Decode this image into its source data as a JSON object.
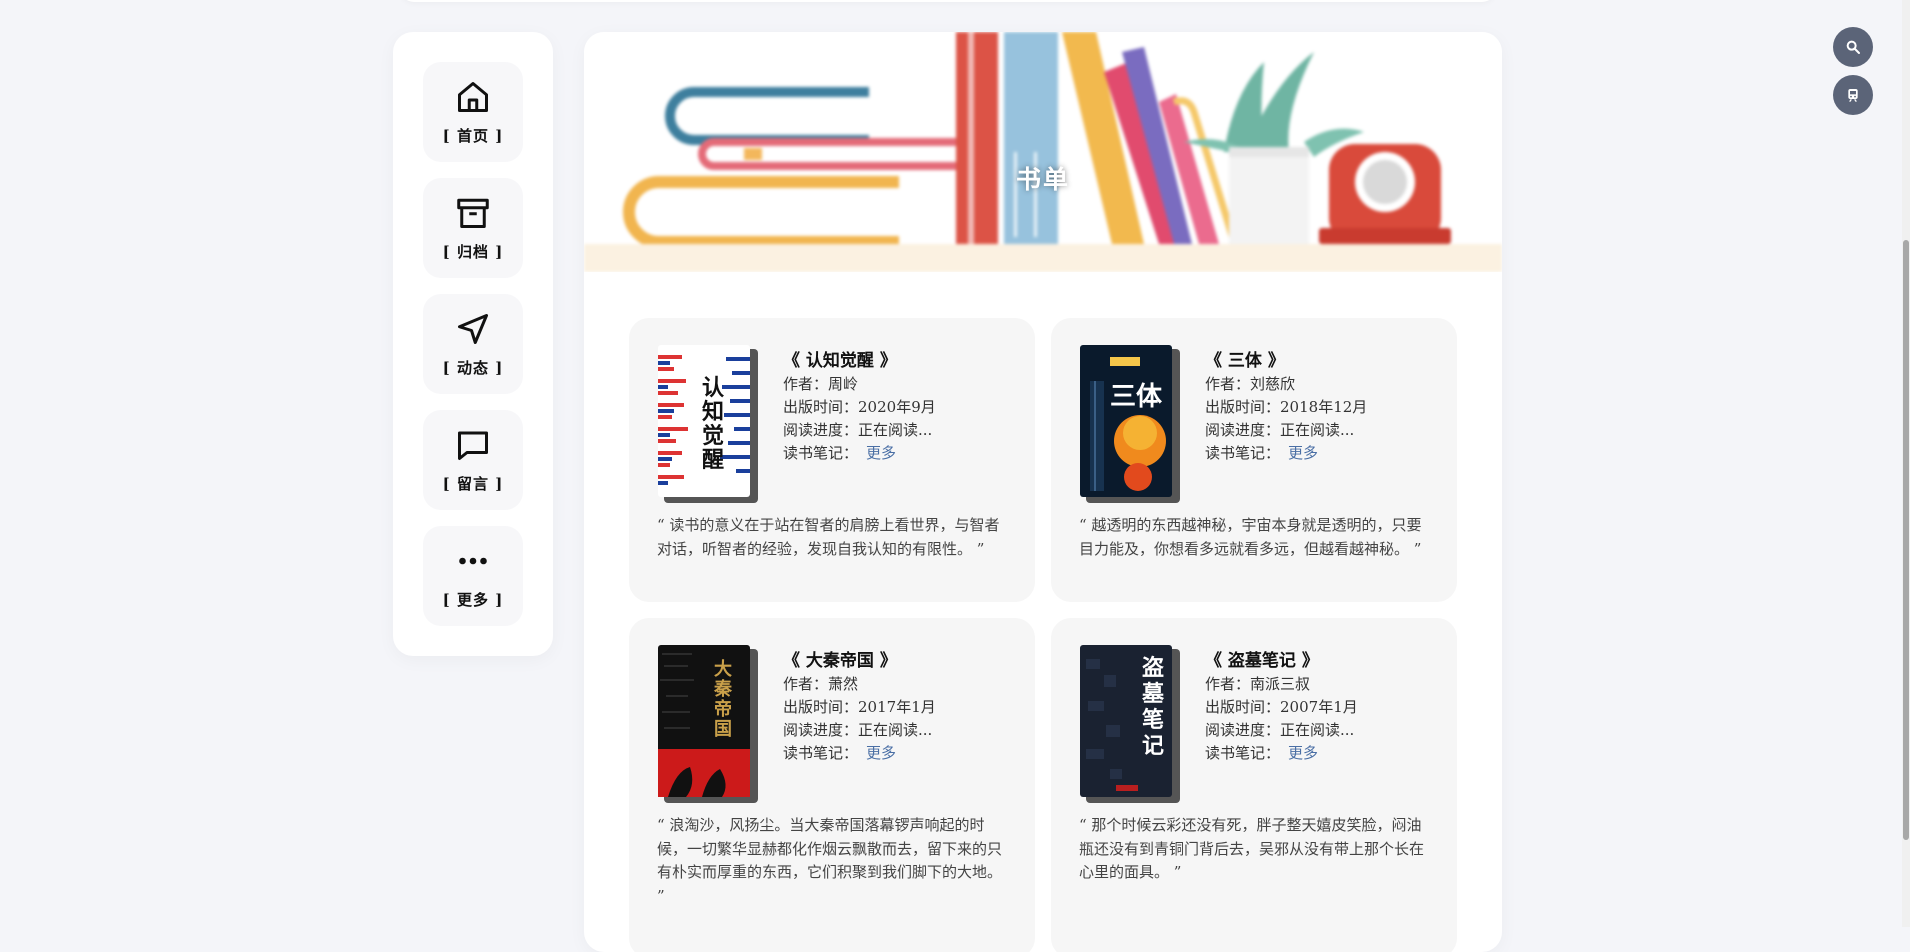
{
  "nav": {
    "items": [
      {
        "label": "[ 首页 ]",
        "icon": "home-icon"
      },
      {
        "label": "[ 归档 ]",
        "icon": "archive-icon"
      },
      {
        "label": "[ 动态 ]",
        "icon": "send-icon"
      },
      {
        "label": "[ 留言 ]",
        "icon": "message-icon"
      },
      {
        "label": "[ 更多 ]",
        "icon": "more-icon"
      }
    ]
  },
  "banner": {
    "title": "书单"
  },
  "labels": {
    "author": "作者：",
    "published": "出版时间：",
    "progress": "阅读进度：",
    "notes": "读书笔记："
  },
  "books": [
    {
      "title": "《 认知觉醒 》",
      "author": "周岭",
      "published": "2020年9月",
      "progress": "正在阅读...",
      "notes_link": "更多",
      "quote": "“ 读书的意义在于站在智者的肩膀上看世界，与智者对话，听智者的经验，发现自我认知的有限性。 ”",
      "cover_text": "认知觉醒"
    },
    {
      "title": "《 三体 》",
      "author": "刘慈欣",
      "published": "2018年12月",
      "progress": "正在阅读...",
      "notes_link": "更多",
      "quote": "“ 越透明的东西越神秘，宇宙本身就是透明的，只要目力能及，你想看多远就看多远，但越看越神秘。 ”",
      "cover_text": "三体"
    },
    {
      "title": "《 大秦帝国 》",
      "author": "萧然",
      "published": "2017年1月",
      "progress": "正在阅读...",
      "notes_link": "更多",
      "quote": "“ 浪淘沙，风扬尘。当大秦帝国落幕锣声响起的时候，一切繁华显赫都化作烟云飘散而去，留下来的只有朴实而厚重的东西，它们积聚到我们脚下的大地。 ”",
      "cover_text": "大秦帝国"
    },
    {
      "title": "《 盗墓笔记 》",
      "author": "南派三叔",
      "published": "2007年1月",
      "progress": "正在阅读...",
      "notes_link": "更多",
      "quote": "“ 那个时候云彩还没有死，胖子整天嬉皮笑脸，闷油瓶还没有到青铜门背后去，吴邪从没有带上那个长在心里的面具。 ”",
      "cover_text": "盗墓笔记"
    }
  ],
  "fabs": [
    "search-icon",
    "train-icon"
  ],
  "colors": {
    "fab": "#5b6478",
    "link": "#4a6fa5",
    "card": "#f6f6f6"
  }
}
